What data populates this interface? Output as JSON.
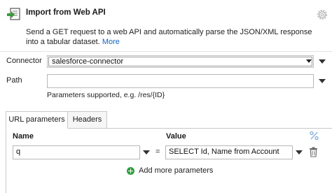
{
  "header": {
    "title": "Import from Web API",
    "description": "Send a GET request to a web API and automatically parse the JSON/XML response into a tabular dataset.",
    "more_link": "More"
  },
  "connector": {
    "label": "Connector",
    "value": "salesforce-connector"
  },
  "path": {
    "label": "Path",
    "value": "",
    "hint": "Parameters supported, e.g. /res/{ID}"
  },
  "tabs": [
    {
      "label": "URL parameters",
      "active": true
    },
    {
      "label": "Headers",
      "active": false
    }
  ],
  "params_table": {
    "name_header": "Name",
    "value_header": "Value",
    "rows": [
      {
        "name": "q",
        "operator": "=",
        "value": "SELECT Id, Name from Account"
      }
    ],
    "add_label": "Add more parameters"
  },
  "icons": {
    "app": "web-api-import-icon",
    "settings": "gear-icon",
    "dropdown": "triangle-down-icon",
    "delete": "trash-icon",
    "variables": "percent-variable-icon"
  },
  "colors": {
    "link": "#1565c0",
    "add": "#2e9e3a",
    "icon_green": "#3a9d3a"
  }
}
